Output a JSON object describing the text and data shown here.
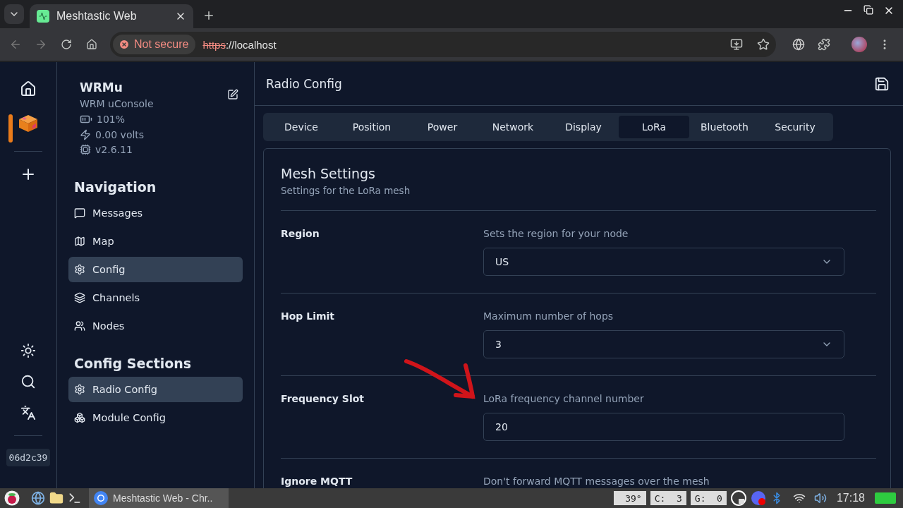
{
  "browser": {
    "tabs": [
      {
        "title": "Meshtastic Web",
        "selected": true
      }
    ],
    "security_label": "Not secure",
    "url_scheme": "https",
    "url_rest": "://localhost"
  },
  "rail": {
    "devices": [
      {
        "selected": true
      }
    ],
    "short_id": "06d2c39"
  },
  "sidebar": {
    "device": {
      "name": "WRMu",
      "model": "WRM uConsole",
      "battery": "101%",
      "voltage": "0.00 volts",
      "firmware": "v2.6.11"
    },
    "sections": [
      {
        "title": "Navigation",
        "items": [
          {
            "label": "Messages",
            "selected": false
          },
          {
            "label": "Map",
            "selected": false
          },
          {
            "label": "Config",
            "selected": true
          },
          {
            "label": "Channels",
            "selected": false
          },
          {
            "label": "Nodes",
            "selected": false
          }
        ]
      },
      {
        "title": "Config Sections",
        "items": [
          {
            "label": "Radio Config",
            "selected": true
          },
          {
            "label": "Module Config",
            "selected": false
          }
        ]
      }
    ]
  },
  "main": {
    "title": "Radio Config",
    "tabs": [
      {
        "label": "Device",
        "selected": false
      },
      {
        "label": "Position",
        "selected": false
      },
      {
        "label": "Power",
        "selected": false
      },
      {
        "label": "Network",
        "selected": false
      },
      {
        "label": "Display",
        "selected": false
      },
      {
        "label": "LoRa",
        "selected": true
      },
      {
        "label": "Bluetooth",
        "selected": false
      },
      {
        "label": "Security",
        "selected": false
      }
    ],
    "card": {
      "title": "Mesh Settings",
      "subtitle": "Settings for the LoRa mesh",
      "rows": [
        {
          "label": "Region",
          "description": "Sets the region for your node",
          "kind": "select",
          "value": "US"
        },
        {
          "label": "Hop Limit",
          "description": "Maximum number of hops",
          "kind": "select",
          "value": "3"
        },
        {
          "label": "Frequency Slot",
          "description": "LoRa frequency channel number",
          "kind": "input",
          "value": "20"
        },
        {
          "label": "Ignore MQTT",
          "description": "Don't forward MQTT messages over the mesh",
          "kind": "none"
        }
      ]
    }
  },
  "taskbar": {
    "window_title": "Meshtastic Web - Chr..",
    "widgets": [
      "39°",
      "C:  3",
      "G:  0"
    ],
    "clock": "17:18"
  }
}
